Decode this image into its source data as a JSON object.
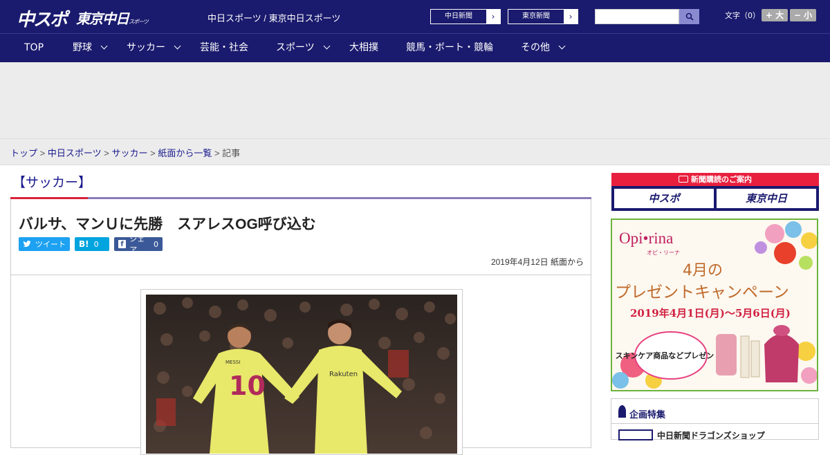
{
  "header": {
    "logo_chuspo": "中スポ",
    "logo_tokyo": "東京中日",
    "logo_tokyo_suffix": "スポーツ",
    "site_title": "中日スポーツ / 東京中日スポーツ",
    "ext_links": [
      "中日新聞",
      "東京新聞"
    ],
    "fontsize_label": "文字（0）",
    "fontsize_larger": "+ 大",
    "fontsize_smaller": "− 小"
  },
  "nav": {
    "items": [
      {
        "label": "TOP"
      },
      {
        "label": "野球"
      },
      {
        "label": "サッカー"
      },
      {
        "label": "芸能・社会"
      },
      {
        "label": "スポーツ"
      },
      {
        "label": "大相撲"
      },
      {
        "label": "競馬・ボート・競輪"
      },
      {
        "label": "その他"
      }
    ]
  },
  "breadcrumb": {
    "items": [
      "トップ",
      "中日スポーツ",
      "サッカー",
      "紙面から一覧"
    ],
    "current": "記事",
    "separator": ">"
  },
  "article": {
    "category": "【サッカー】",
    "headline": "バルサ、マンＵに先勝　スアレスOG呼び込む",
    "share": {
      "tweet": "ツイート",
      "hatena": "B!",
      "hatena_count": "0",
      "facebook": "シェア",
      "facebook_count": "0"
    },
    "dateline": "2019年4月12日 紙面から"
  },
  "sidebar": {
    "subscription_head": "新聞購読のご案内",
    "sub_logos": [
      "中スポ",
      "東京中日"
    ],
    "promo": {
      "brand": "Opi•rina",
      "brand_kana": "オピ・リーナ",
      "month": "4月の",
      "campaign": "プレゼントキャンペーン",
      "period": "2019年4月1日(月)～5月6日(月)",
      "badge": "スキンケア商品などプレゼント♪"
    },
    "kikaku_title": "企画特集",
    "kikaku_item": "中日新聞ドラゴンズショップ"
  },
  "colors": {
    "navy": "#1a1a6e",
    "accent_red": "#d8203a",
    "twitter": "#1da1f2",
    "hatena": "#00a4de",
    "facebook": "#3b5998"
  }
}
